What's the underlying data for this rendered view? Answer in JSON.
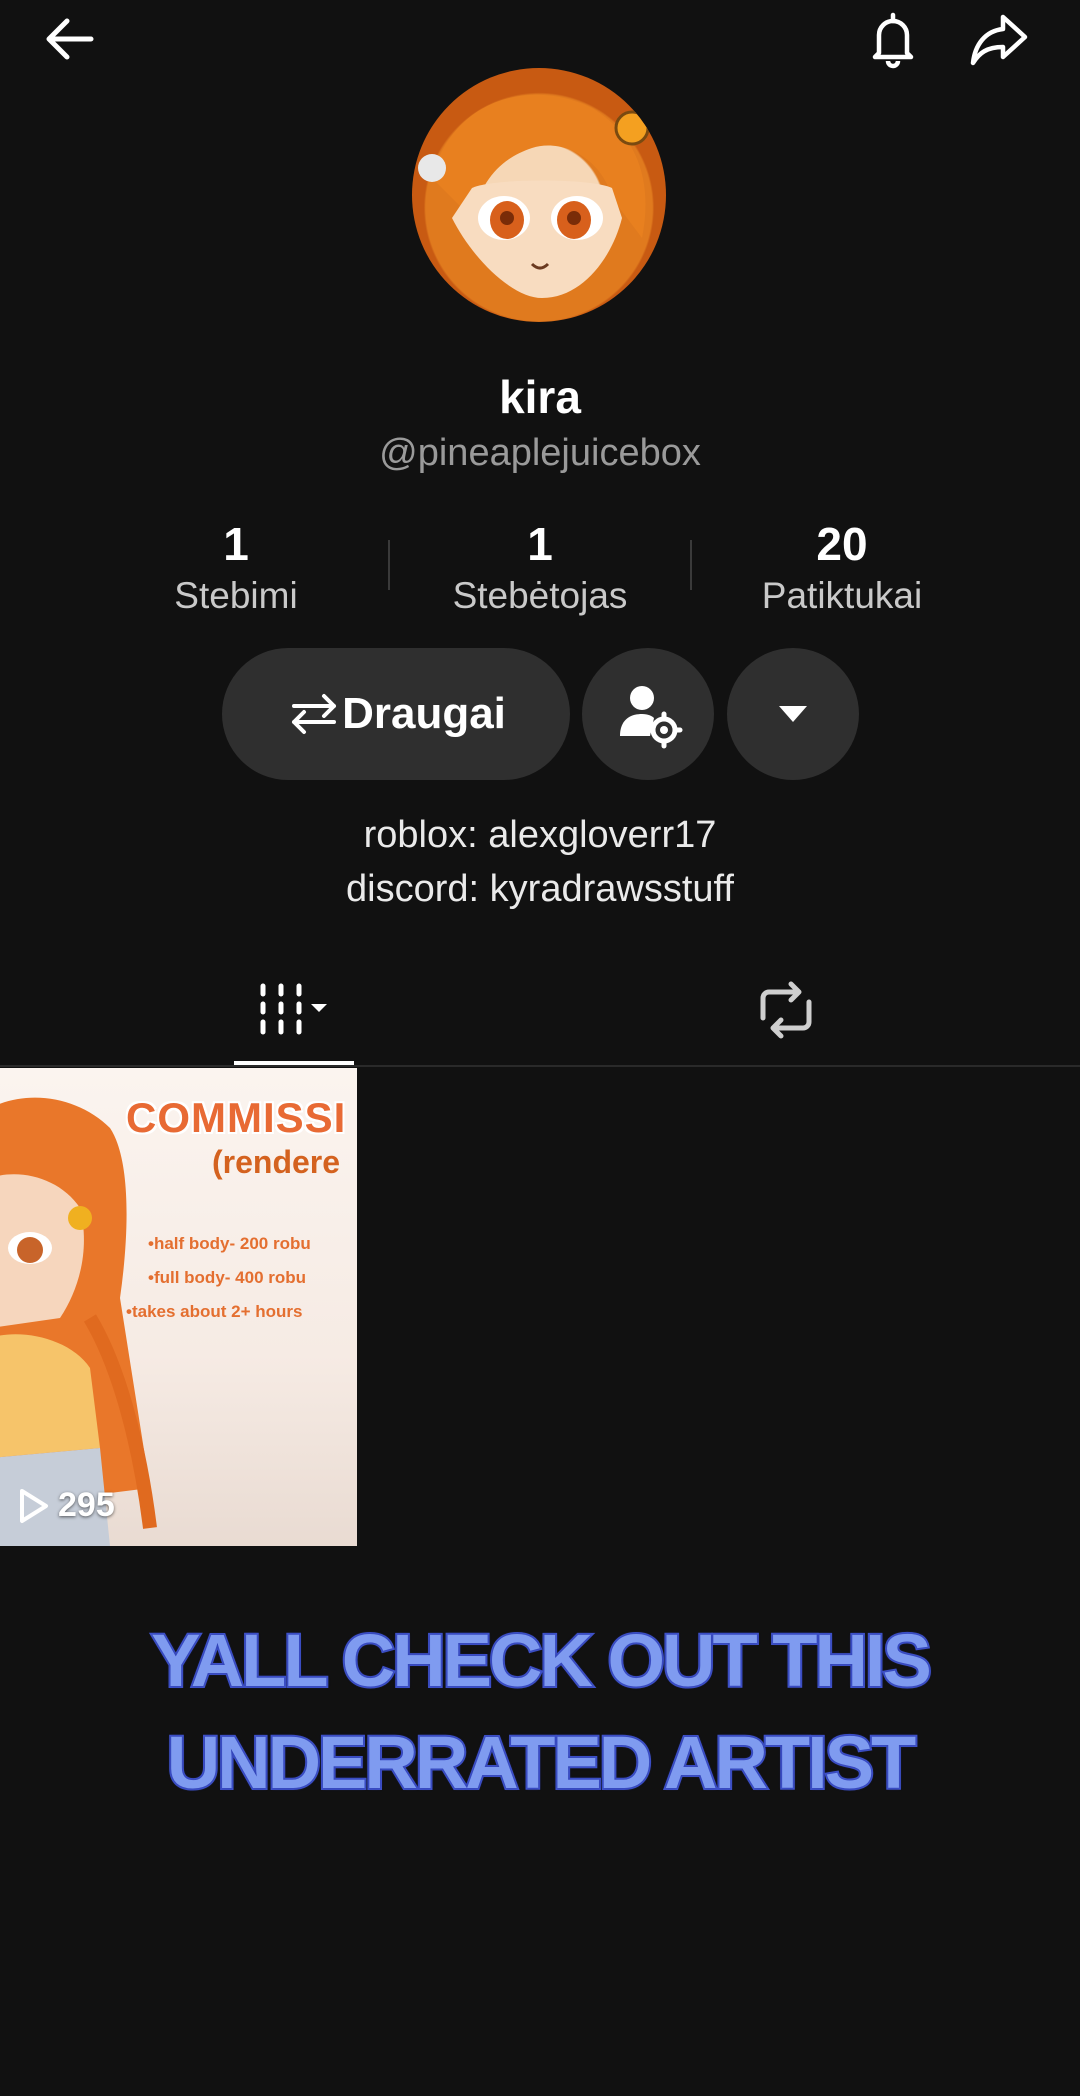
{
  "profile": {
    "name": "kira",
    "handle": "@pineaplejuicebox",
    "avatar_icon": "anime-avatar"
  },
  "stats": [
    {
      "value": "1",
      "label": "Stebimi"
    },
    {
      "value": "1",
      "label": "Stebėtojas"
    },
    {
      "value": "20",
      "label": "Patiktukai"
    }
  ],
  "actions": {
    "friends_label": "Draugai",
    "friends_icon": "swap-arrows-icon",
    "settings_icon": "user-gear-icon",
    "more_icon": "caret-down-icon"
  },
  "bio": {
    "line1": "roblox: alexgloverr17",
    "line2": "discord: kyradrawsstuff"
  },
  "tabs": {
    "videos_icon": "grid-icon",
    "reposts_icon": "repost-icon"
  },
  "video": {
    "title_text": "COMMISSI",
    "subtitle_text": "(rendere",
    "line1": "•half body- 200 robu",
    "line2": "•full body- 400 robu",
    "line3": "•takes about 2+ hours",
    "views": "295"
  },
  "overlay_caption": {
    "line1": "YALL  CHECK OUT THIS",
    "line2": "UNDERRATED ARTIST"
  },
  "colors": {
    "background": "#111111",
    "button_bg": "#2f2f2f",
    "caption_fill": "#7f9bf0",
    "caption_stroke": "#3f52c9",
    "avatar_orange": "#e07a1e"
  }
}
